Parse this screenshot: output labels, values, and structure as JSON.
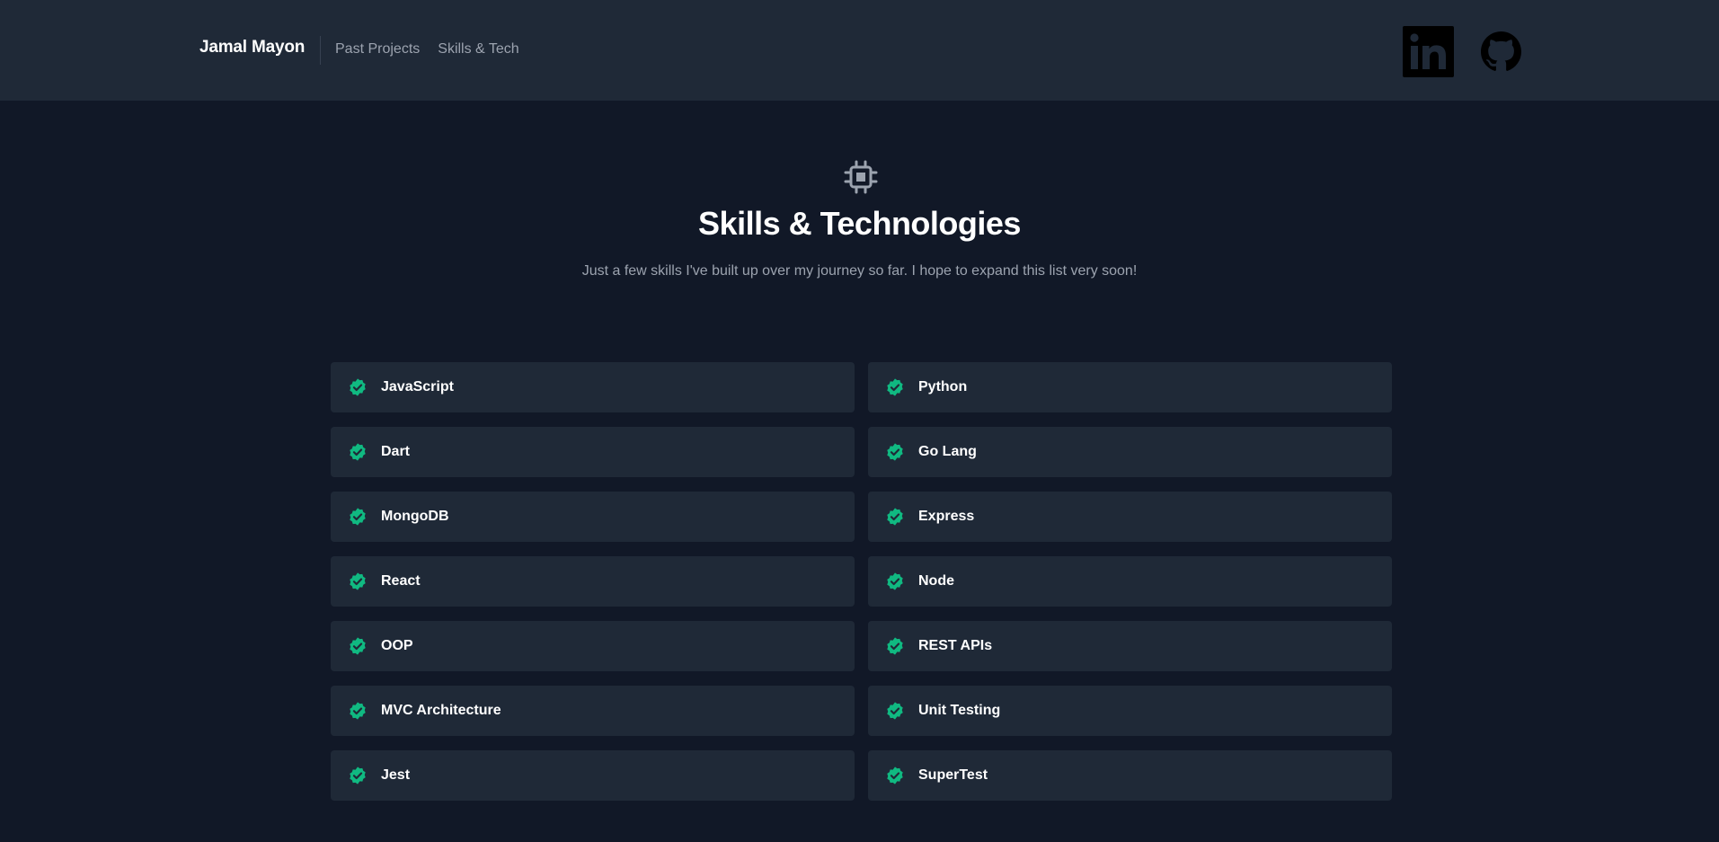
{
  "header": {
    "brand": "Jamal Mayon",
    "nav": [
      {
        "label": "Past Projects"
      },
      {
        "label": "Skills & Tech"
      }
    ],
    "social": [
      {
        "icon": "linkedin-icon",
        "name": "LinkedIn"
      },
      {
        "icon": "github-icon",
        "name": "GitHub"
      }
    ]
  },
  "hero": {
    "icon": "chip-icon",
    "title": "Skills & Technologies",
    "subtitle": "Just a few skills I've built up over my journey so far. I hope to expand this list very soon!"
  },
  "skills": [
    "JavaScript",
    "Python",
    "Dart",
    "Go Lang",
    "MongoDB",
    "Express",
    "React",
    "Node",
    "OOP",
    "REST APIs",
    "MVC Architecture",
    "Unit Testing",
    "Jest",
    "SuperTest"
  ],
  "colors": {
    "background": "#111827",
    "surface": "#1f2937",
    "accent": "#10b981",
    "muted_text": "#9ca3af"
  }
}
